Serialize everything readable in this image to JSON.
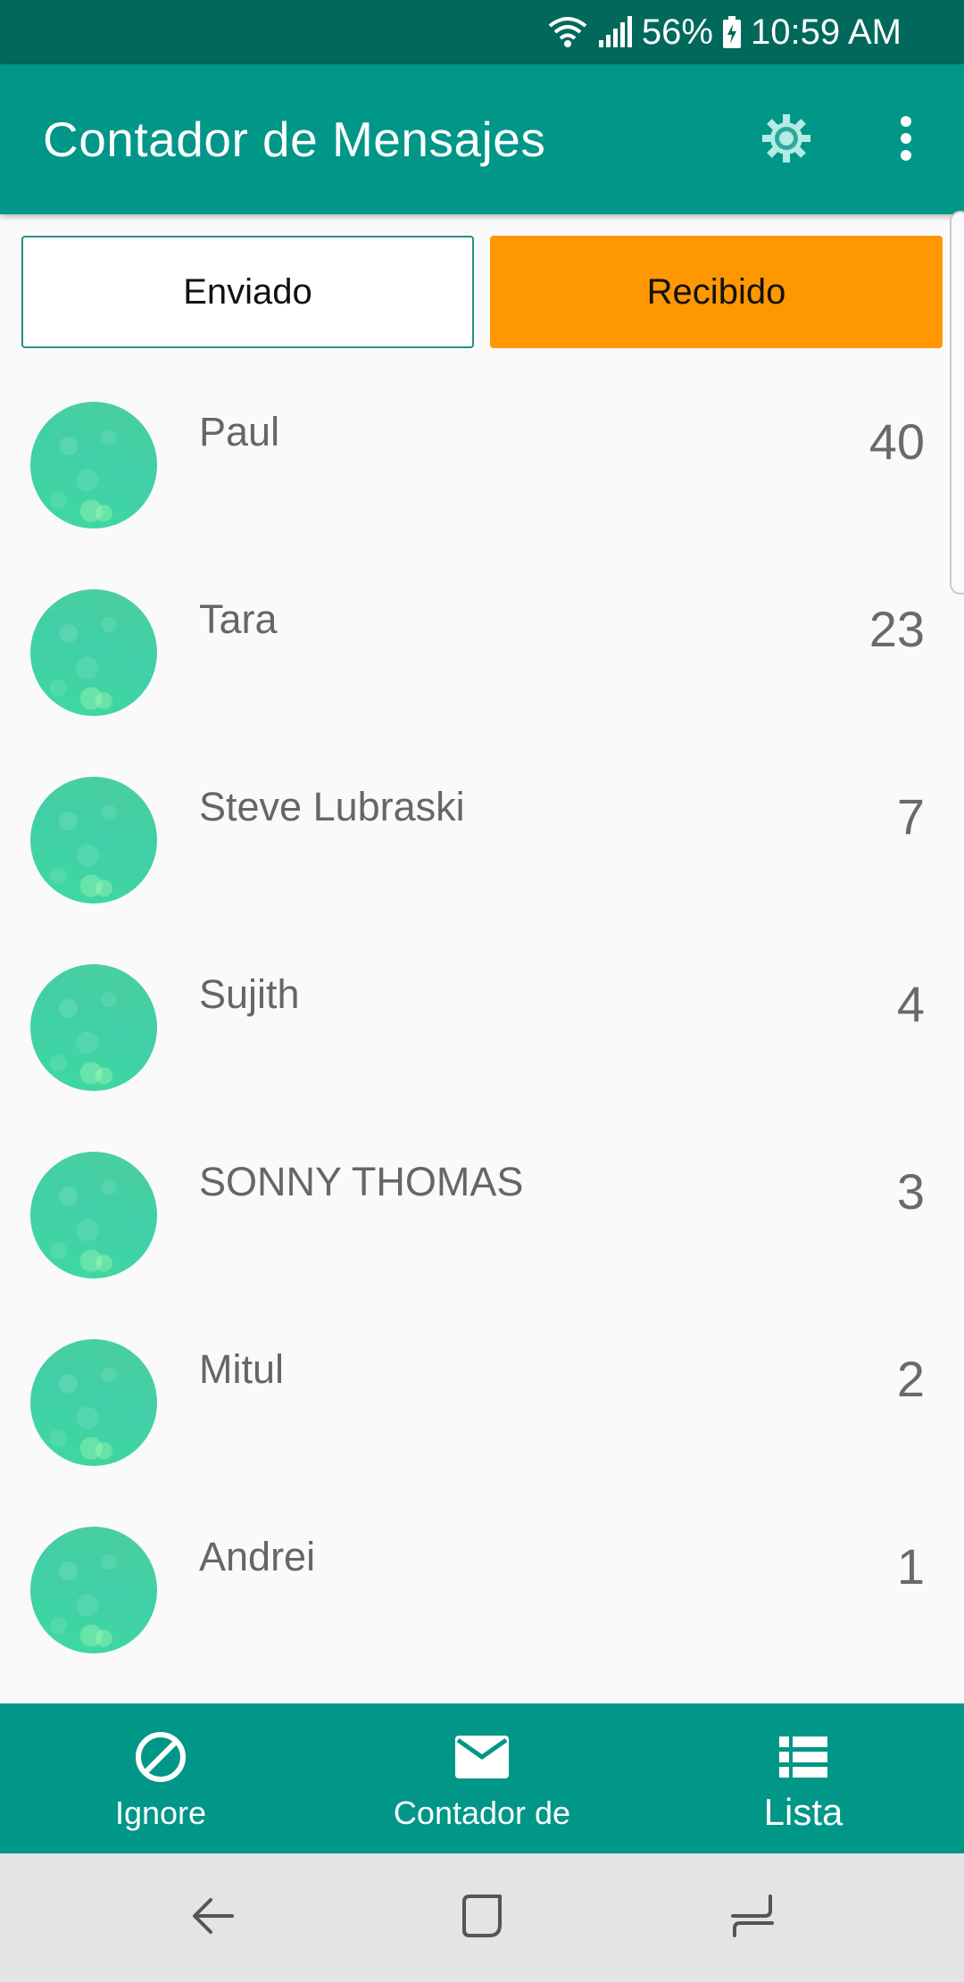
{
  "status_bar": {
    "battery": "56%",
    "time": "10:59 AM",
    "icons": [
      "wifi-icon",
      "signal-icon",
      "battery-icon"
    ]
  },
  "app_bar": {
    "title": "Contador de Mensajes",
    "icons": [
      "settings-gear-icon",
      "more-vert-icon"
    ]
  },
  "toggle": {
    "sent_label": "Enviado",
    "received_label": "Recibido",
    "selected": "Recibido"
  },
  "contacts": [
    {
      "name": "Paul",
      "count": "40"
    },
    {
      "name": "Tara",
      "count": "23"
    },
    {
      "name": "Steve Lubraski",
      "count": "7"
    },
    {
      "name": "Sujith",
      "count": "4"
    },
    {
      "name": "SONNY THOMAS",
      "count": "3"
    },
    {
      "name": "Mitul",
      "count": "2"
    },
    {
      "name": "Andrei",
      "count": "1"
    }
  ],
  "bottom_nav": {
    "items": [
      {
        "label": "Ignore",
        "icon": "block-icon"
      },
      {
        "label": "Contador de",
        "icon": "mail-icon"
      },
      {
        "label": "Lista",
        "icon": "list-icon"
      }
    ]
  },
  "system_nav": {
    "icons": [
      "back-icon",
      "home-icon",
      "recents-icon"
    ]
  },
  "colors": {
    "status_bar": "#00695c",
    "primary": "#009688",
    "accent_selected": "#ff9800",
    "background": "#fafafa",
    "system_nav": "#e4e4e4"
  }
}
